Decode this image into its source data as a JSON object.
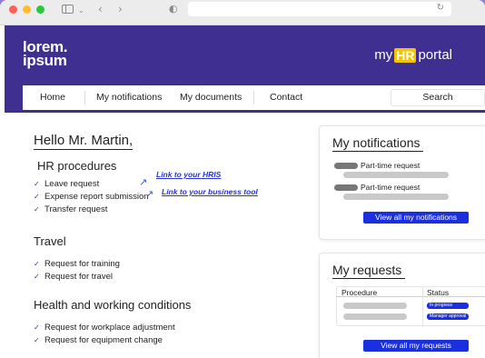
{
  "browser": {
    "back_icon": "chevron-left-icon",
    "forward_icon": "chevron-right-icon",
    "reload_icon": "reload-icon"
  },
  "header": {
    "logo_line1": "lorem.",
    "logo_line2": "ipsum",
    "portal_prefix": "my",
    "portal_hr": "HR",
    "portal_suffix": "portal",
    "accent_color": "#f5c400",
    "brand_color": "#3e2f91"
  },
  "nav": {
    "items": [
      "Home",
      "My notifications",
      "My documents",
      "Contact"
    ],
    "search_label": "Search"
  },
  "main": {
    "greeting": "Hello Mr. Martin,",
    "hr_title": "HR procedures",
    "hr_items": [
      "Leave request",
      "Expense report submission",
      "Transfer request"
    ],
    "hris_link": "Link to your HRIS",
    "business_link": "Link to your business tool",
    "travel_title": "Travel",
    "travel_items": [
      "Request for training",
      "Request for travel"
    ],
    "health_title": "Health and working conditions",
    "health_items": [
      "Request for workplace adjustment",
      "Request for equipment change"
    ]
  },
  "notifications": {
    "title": "My notifications",
    "items": [
      "Part-time request",
      "Part-time request"
    ],
    "button": "View all my notifications"
  },
  "requests": {
    "title": "My requests",
    "col_procedure": "Procedure",
    "col_status": "Status",
    "statuses": [
      "In progress",
      "Manager approval"
    ],
    "button": "View all my requests",
    "status_color": "#1a2fe0"
  }
}
